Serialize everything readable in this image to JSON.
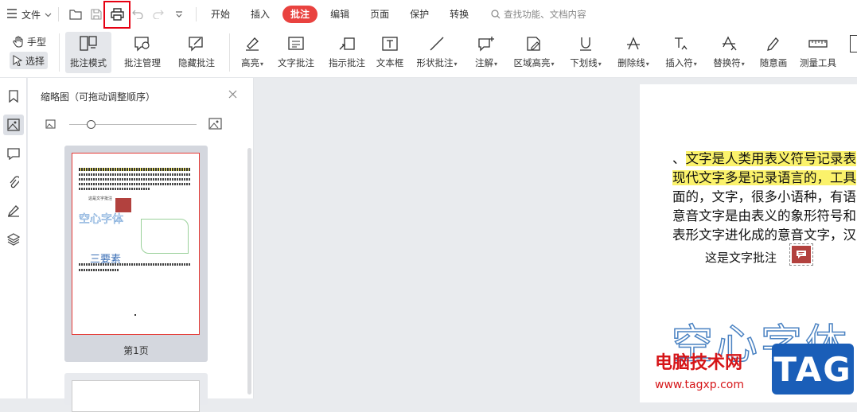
{
  "menubar": {
    "file_label": "文件",
    "tabs": [
      {
        "label": "开始"
      },
      {
        "label": "插入"
      },
      {
        "label": "批注"
      },
      {
        "label": "编辑"
      },
      {
        "label": "页面"
      },
      {
        "label": "保护"
      },
      {
        "label": "转换"
      }
    ],
    "active_tab": "批注",
    "search_placeholder": "查找功能、文档内容"
  },
  "ribbon": {
    "hand_label": "手型",
    "select_label": "选择",
    "tools": [
      {
        "label": "批注模式",
        "icon": "annotation-mode-icon"
      },
      {
        "label": "批注管理",
        "icon": "annotation-manage-icon"
      },
      {
        "label": "隐藏批注",
        "icon": "hide-annotation-icon"
      },
      {
        "label": "高亮",
        "icon": "highlight-icon"
      },
      {
        "label": "文字批注",
        "icon": "text-annotation-icon"
      },
      {
        "label": "指示批注",
        "icon": "pointer-annotation-icon"
      },
      {
        "label": "文本框",
        "icon": "textbox-icon"
      },
      {
        "label": "形状批注",
        "icon": "shape-annotation-icon"
      },
      {
        "label": "注解",
        "icon": "note-icon"
      },
      {
        "label": "区域高亮",
        "icon": "area-highlight-icon"
      },
      {
        "label": "下划线",
        "icon": "underline-icon"
      },
      {
        "label": "删除线",
        "icon": "strikethrough-icon"
      },
      {
        "label": "插入符",
        "icon": "insert-caret-icon"
      },
      {
        "label": "替换符",
        "icon": "replace-caret-icon"
      },
      {
        "label": "随意画",
        "icon": "freehand-icon"
      },
      {
        "label": "测量工具",
        "icon": "ruler-icon"
      }
    ]
  },
  "thumbnail_panel": {
    "title": "缩略图（可拖动调整顺序）",
    "page_label": "第1页",
    "thumb_small_title": "空心字体",
    "thumb_small_heading": "三要素",
    "thumb_small_note": "这是文字批注"
  },
  "document": {
    "lines": [
      {
        "prefix": "、",
        "highlight": "文字是人类用表义符号记录表"
      },
      {
        "prefix": "",
        "highlight": "现代文字多是记录语言的，工具"
      },
      {
        "prefix": "面的，文字，很多小语种，有语",
        "highlight": ""
      },
      {
        "prefix": "意音文字是由表义的象形符号和",
        "highlight": ""
      },
      {
        "prefix": "表形文字进化成的意音文字，汉",
        "highlight": ""
      }
    ],
    "note_text": "这是文字批注",
    "hollow_text": "空心字体"
  },
  "watermark": {
    "site_name": "电脑技术网",
    "url": "www.tagxp.com",
    "tag": "TAG"
  }
}
